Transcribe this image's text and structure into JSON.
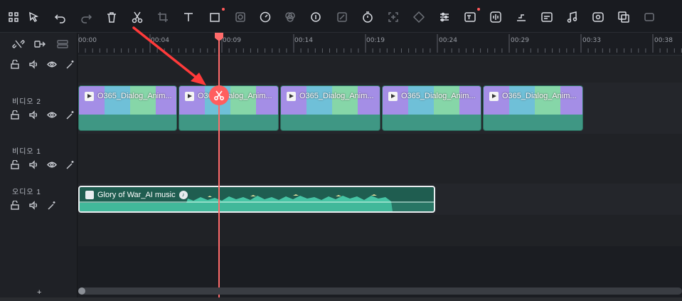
{
  "toolbar": {
    "icons": [
      "grid-icon",
      "select-icon",
      "undo-icon",
      "redo-icon",
      "delete-icon",
      "scissors-icon",
      "crop-icon",
      "text-icon",
      "rectangle-icon",
      "mask-icon",
      "speed-icon",
      "color-icon",
      "ai-audio-icon",
      "edit-icon",
      "timer-icon",
      "freeze-icon",
      "keyframe-icon",
      "adjust-icon",
      "ai-text-icon",
      "audio-wave-icon",
      "split-audio-icon",
      "ai-caption-icon",
      "music-icon",
      "voice-icon",
      "translate-icon",
      "more-icon"
    ]
  },
  "ruler": {
    "ticks": [
      "00:00",
      "00:04",
      "00:09",
      "00:14",
      "00:19",
      "00:24",
      "00:29",
      "00:33",
      "00:38"
    ]
  },
  "tracks": {
    "video2_name": "비디오 2",
    "video1_name": "비디오 1",
    "audio1_name": "오디오 1"
  },
  "clips": [
    {
      "label": "O365_Dialog_Anim..."
    },
    {
      "label": "O365_Dialog_Anim..."
    },
    {
      "label": "O365_Dialog_Anim..."
    },
    {
      "label": "O365_Dialog_Anim..."
    },
    {
      "label": "O365_Dialog_Anim..."
    }
  ],
  "audio_clip": {
    "label": "Glory of War_AI music"
  },
  "add_track": "+",
  "colors": {
    "playhead": "#ff6b6b",
    "video_clip": "#3f9784",
    "audio_clip": "#1f5d50",
    "accent_dot": "#ff5a5a"
  }
}
